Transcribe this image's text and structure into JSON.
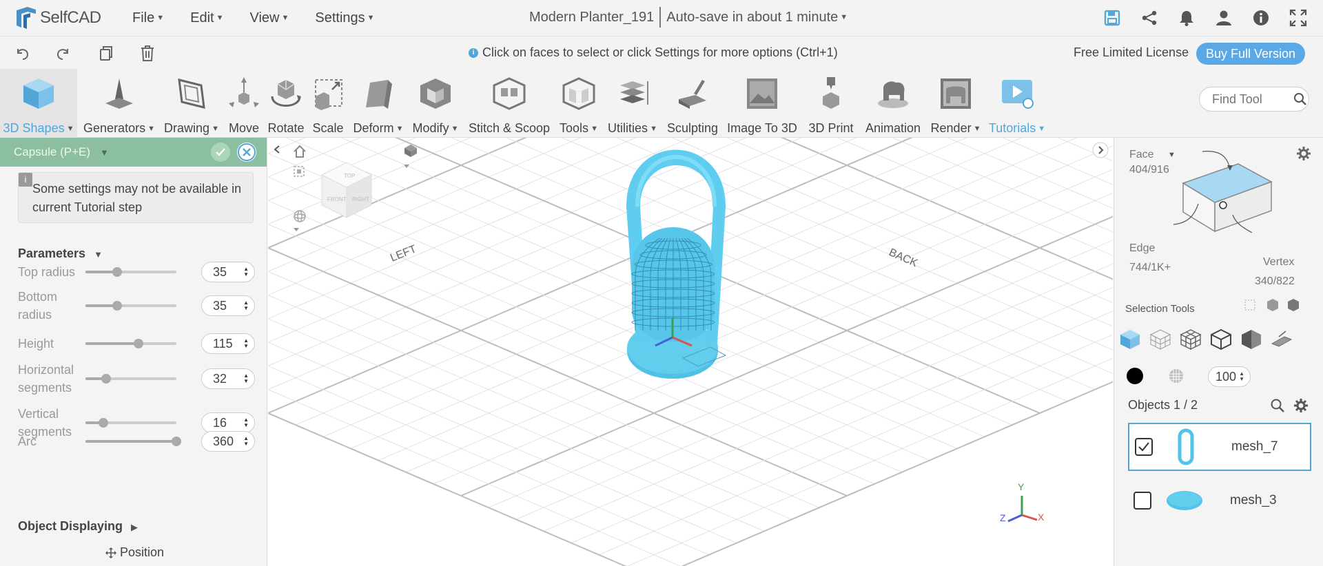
{
  "app": {
    "name": "SelfCAD"
  },
  "menu": [
    {
      "label": "File"
    },
    {
      "label": "Edit"
    },
    {
      "label": "View"
    },
    {
      "label": "Settings"
    }
  ],
  "document": {
    "title": "Modern Planter_191",
    "autosave": "Auto-save in about 1 minute"
  },
  "top_icons": [
    "save-icon",
    "share-icon",
    "bell-icon",
    "user-icon",
    "info-icon",
    "fullscreen-icon"
  ],
  "hint": "Click on faces to select or click Settings for more options (Ctrl+1)",
  "license": {
    "text": "Free Limited License",
    "button": "Buy Full Version"
  },
  "accent_color": "#52a6d8",
  "toolbar": {
    "tools": [
      {
        "label": "3D Shapes",
        "dropdown": true
      },
      {
        "label": "Generators",
        "dropdown": true
      },
      {
        "label": "Drawing",
        "dropdown": true
      },
      {
        "label": "Move",
        "dropdown": false
      },
      {
        "label": "Rotate",
        "dropdown": false
      },
      {
        "label": "Scale",
        "dropdown": false
      },
      {
        "label": "Deform",
        "dropdown": true
      },
      {
        "label": "Modify",
        "dropdown": true
      },
      {
        "label": "Stitch & Scoop",
        "dropdown": false
      },
      {
        "label": "Tools",
        "dropdown": true
      },
      {
        "label": "Utilities",
        "dropdown": true
      },
      {
        "label": "Sculpting",
        "dropdown": false
      },
      {
        "label": "Image To 3D",
        "dropdown": false
      },
      {
        "label": "3D Print",
        "dropdown": false
      },
      {
        "label": "Animation",
        "dropdown": false
      },
      {
        "label": "Render",
        "dropdown": true
      },
      {
        "label": "Tutorials",
        "dropdown": true
      }
    ],
    "find_tool_placeholder": "Find Tool"
  },
  "left_panel": {
    "title": "Capsule (P+E)",
    "note": "Some settings may not be available in current Tutorial step",
    "parameters_title": "Parameters",
    "parameters": [
      {
        "label": "Top radius",
        "value": "35",
        "fraction": 0.35
      },
      {
        "label": "Bottom radius",
        "value": "35",
        "fraction": 0.35
      },
      {
        "label": "Height",
        "value": "115",
        "fraction": 0.58
      },
      {
        "label": "Horizontal segments",
        "value": "32",
        "fraction": 0.23
      },
      {
        "label": "Vertical segments",
        "value": "16",
        "fraction": 0.2
      },
      {
        "label": "Arc",
        "value": "360",
        "fraction": 1.0
      }
    ],
    "object_displaying": "Object Displaying",
    "position": "Position"
  },
  "viewport": {
    "labels": {
      "left": "LEFT",
      "back": "BACK"
    },
    "cube_faces": {
      "top": "TOP",
      "front": "FRONT",
      "right": "RIGHT"
    },
    "axes": {
      "x": "X",
      "y": "Y",
      "z": "Z"
    }
  },
  "right_panel": {
    "face": {
      "label": "Face",
      "count": "404/916"
    },
    "edge": {
      "label": "Edge",
      "count": "744/1K+"
    },
    "vertex": {
      "label": "Vertex",
      "count": "340/822"
    },
    "selection_tools": "Selection Tools",
    "opacity": "100",
    "objects_title": "Objects 1 / 2",
    "objects": [
      {
        "name": "mesh_7",
        "checked": true,
        "selected": true
      },
      {
        "name": "mesh_3",
        "checked": false,
        "selected": false
      }
    ]
  }
}
